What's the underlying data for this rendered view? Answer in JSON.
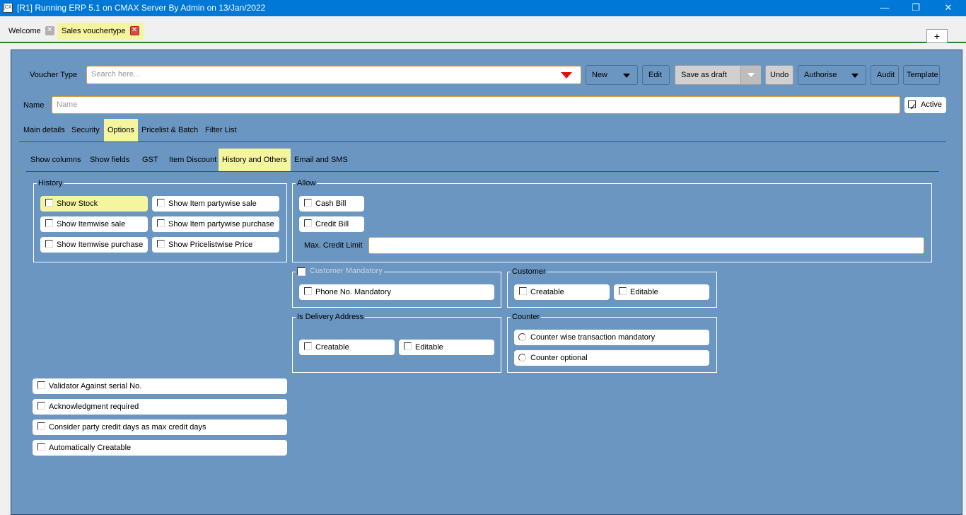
{
  "window": {
    "icon_text": "[CX]",
    "title": "[R1] Running ERP 5.1 on CMAX Server By Admin on 13/Jan/2022",
    "min": "—",
    "restore": "❐",
    "close": "✕"
  },
  "tabs": [
    {
      "label": "Welcome"
    },
    {
      "label": "Sales vouchertype"
    }
  ],
  "plus_label": "+",
  "toolbar": {
    "voucher_type_label": "Voucher Type",
    "search_placeholder": "Search here...",
    "new_label": "New",
    "edit_label": "Edit",
    "save_draft_label": "Save as draft",
    "undo_label": "Undo",
    "authorise_label": "Authorise",
    "audit_label": "Audit",
    "template_label": "Template"
  },
  "name_row": {
    "label": "Name",
    "placeholder": "Name",
    "active_label": "Active",
    "active_checked": true
  },
  "main_tabs": [
    "Main details",
    "Security",
    "Options",
    "Pricelist & Batch",
    "Filter List"
  ],
  "main_tab_selected": "Options",
  "sub_tabs": [
    "Show columns",
    "Show fields",
    "GST",
    "Item Discount",
    "History and Others",
    "Email and SMS"
  ],
  "sub_tab_selected": "History and Others",
  "history": {
    "title": "History",
    "items": [
      "Show Stock",
      "Show Item partywise sale",
      "Show Itemwise sale",
      "Show Item partywise purchase",
      "Show Itemwise purchase",
      "Show Pricelistwise Price"
    ]
  },
  "allow": {
    "title": "Allow",
    "cash_bill": "Cash Bill",
    "credit_bill": "Credit Bill",
    "max_credit_label": "Max. Credit Limit"
  },
  "customer_mandatory": {
    "title": "Customer Mandatory",
    "phone": "Phone No. Mandatory"
  },
  "customer": {
    "title": "Customer",
    "creatable": "Creatable",
    "editable": "Editable"
  },
  "delivery": {
    "title": "Is Delivery Address",
    "creatable": "Creatable",
    "editable": "Editable"
  },
  "counter": {
    "title": "Counter",
    "mandatory": "Counter wise transaction mandatory",
    "optional": "Counter optional"
  },
  "bottom_options": [
    "Validator Against serial No.",
    "Acknowledgment required",
    "Consider party credit days as max credit days",
    "Automatically Creatable"
  ],
  "colors": {
    "accent": "#0078d7",
    "panel": "#6a96c1",
    "highlight": "#f4f59e",
    "divider": "#1e6a2a"
  }
}
